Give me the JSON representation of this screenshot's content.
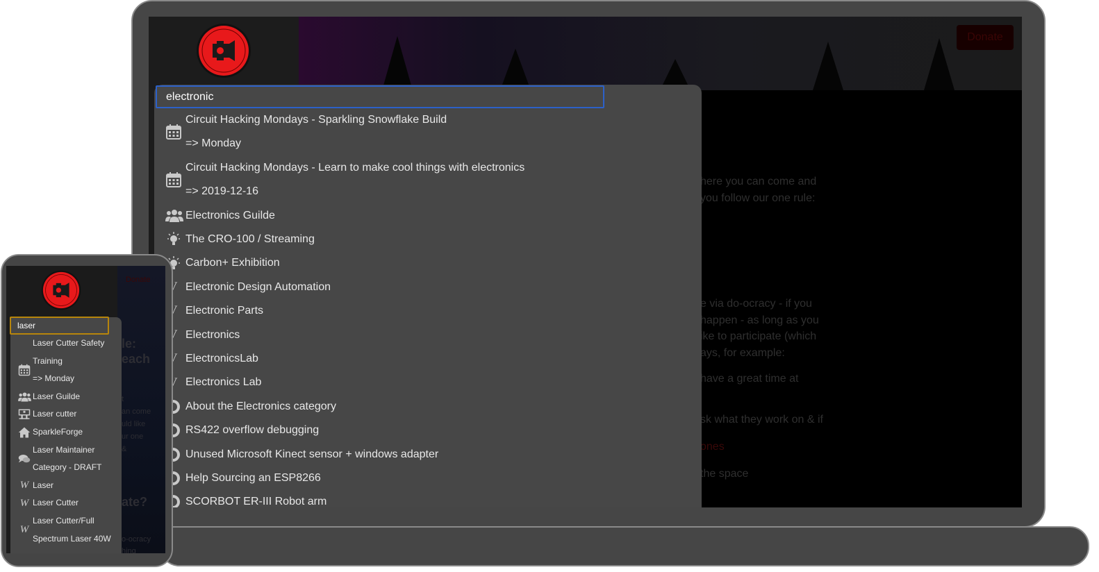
{
  "laptop": {
    "donate_label": "Donate",
    "search": {
      "value": "electronic",
      "placeholder": ""
    },
    "results": [
      {
        "icon": "calendar-icon",
        "title": "Circuit Hacking Mondays - Sparkling Snowflake Build",
        "sub": "=> Monday"
      },
      {
        "icon": "calendar-icon",
        "title": "Circuit Hacking Mondays - Learn to make cool things with electronics",
        "sub": "=> 2019-12-16"
      },
      {
        "icon": "users-icon",
        "title": "Electronics Guilde"
      },
      {
        "icon": "lightbulb-icon",
        "title": "The CRO-100 / Streaming"
      },
      {
        "icon": "lightbulb-icon",
        "title": "Carbon+ Exhibition"
      },
      {
        "icon": "wikipedia-icon",
        "title": "Electronic Design Automation"
      },
      {
        "icon": "wikipedia-icon",
        "title": "Electronic Parts"
      },
      {
        "icon": "wikipedia-icon",
        "title": "Electronics"
      },
      {
        "icon": "wikipedia-icon",
        "title": "ElectronicsLab"
      },
      {
        "icon": "wikipedia-icon",
        "title": "Electronics Lab"
      },
      {
        "icon": "discourse-icon",
        "title": "About the Electronics category"
      },
      {
        "icon": "discourse-icon",
        "title": "RS422 overflow debugging"
      },
      {
        "icon": "discourse-icon",
        "title": "Unused Microsoft Kinect sensor + windows adapter"
      },
      {
        "icon": "discourse-icon",
        "title": "Help Sourcing an ESP8266"
      },
      {
        "icon": "discourse-icon",
        "title": "SCORBOT ER-III Robot arm"
      }
    ],
    "background_text": {
      "line1": "here you can come and",
      "line2": "you follow our one rule:",
      "line3": "e via do-ocracy - if you",
      "line4": "happen - as long as you",
      "line5": "ike to participate (which",
      "line6": "ays, for example:",
      "line7": "have a great time at",
      "line8": "sk what they work on & if",
      "line9": "ones",
      "line10": "the space"
    }
  },
  "phone": {
    "donate_label": "Donate",
    "search": {
      "value": "laser",
      "placeholder": ""
    },
    "results": [
      {
        "icon": "",
        "title": "Laser Cutter Safety"
      },
      {
        "icon": "calendar-icon",
        "title": "Training",
        "sub": "=> Monday"
      },
      {
        "icon": "users-icon",
        "title": "Laser Guilde"
      },
      {
        "icon": "tool-icon",
        "title": "Laser cutter"
      },
      {
        "icon": "home-icon",
        "title": "SparkleForge"
      },
      {
        "icon": "chat-icon",
        "title": "Laser Maintainer",
        "sub": "Category - DRAFT"
      },
      {
        "icon": "wikipedia-icon",
        "title": "Laser"
      },
      {
        "icon": "wikipedia-icon",
        "title": "Laser Cutter"
      },
      {
        "icon": "wikipedia-icon",
        "title": "Laser Cutter/Full",
        "sub": "Spectrum Laser 40W"
      }
    ],
    "background_text": {
      "h1": "le:",
      "h2": "each",
      "p1": "t",
      "p2": "an come",
      "p3": "uld like",
      "p4": "ur one",
      "p5": "&",
      "h3": "ate?",
      "p6": "o-ocracy",
      "p7": "hing"
    }
  },
  "colors": {
    "panel": "#474747",
    "laptop_focus": "#2c61c9",
    "phone_focus": "#b8860b",
    "logo_red": "#e8191b"
  }
}
